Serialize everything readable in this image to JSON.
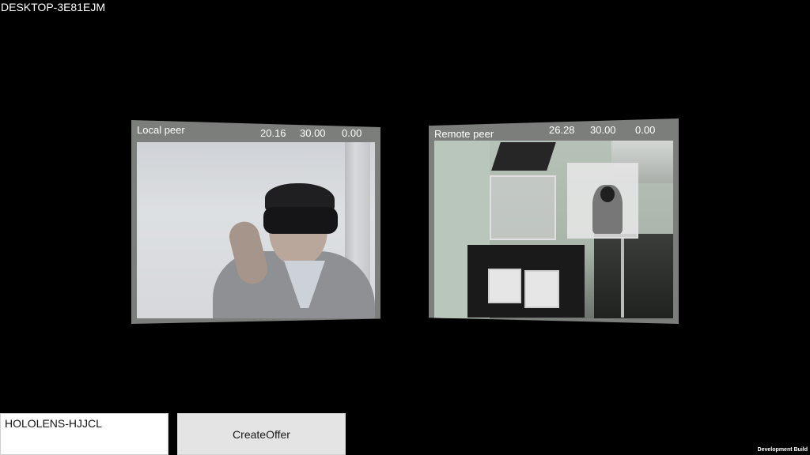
{
  "machine_name": "DESKTOP-3E81EJM",
  "local_peer": {
    "title": "Local peer",
    "stats": [
      "20.16",
      "30.00",
      "0.00"
    ]
  },
  "remote_peer": {
    "title": "Remote peer",
    "stats": [
      "26.28",
      "30.00",
      "0.00"
    ]
  },
  "controls": {
    "peer_name_value": "HOLOLENS-HJJCL",
    "create_offer_label": "CreateOffer"
  },
  "build_label": "Development Build"
}
